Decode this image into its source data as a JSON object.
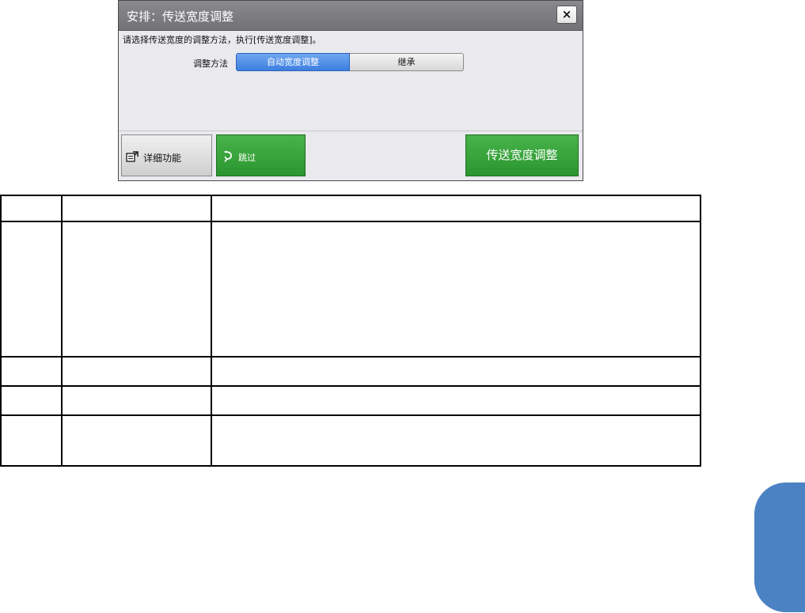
{
  "dialog": {
    "title": "安排：传送宽度调整",
    "close_label": "×",
    "instruction": "请选择传送宽度的调整方法，执行[传送宽度调整]。",
    "method_label": "调整方法",
    "options": [
      {
        "label": "自动宽度调整",
        "selected": true
      },
      {
        "label": "继承",
        "selected": false
      }
    ],
    "buttons": {
      "detail_label": "详细功能",
      "skip_label": "跳过",
      "adjust_label": "传送宽度调整"
    }
  },
  "table": {
    "rows": 5,
    "columns": 3,
    "cells": []
  },
  "colors": {
    "accent_blue": "#3c7fe0",
    "action_green": "#2b962f",
    "side_tab": "#4b82c3"
  }
}
